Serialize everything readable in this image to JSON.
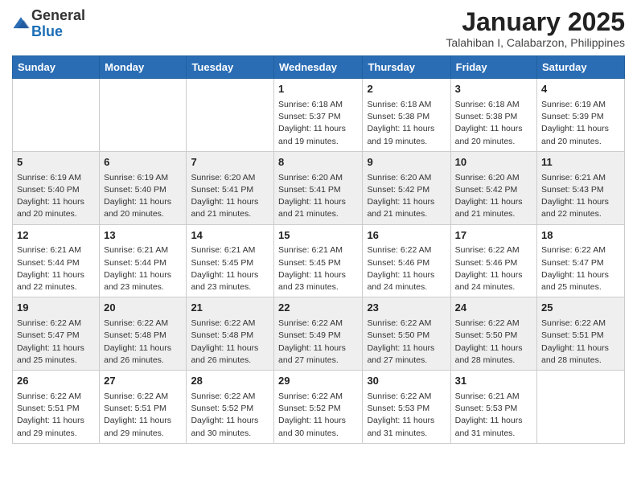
{
  "logo": {
    "line1": "General",
    "line2": "Blue"
  },
  "header": {
    "month": "January 2025",
    "location": "Talahiban I, Calabarzon, Philippines"
  },
  "weekdays": [
    "Sunday",
    "Monday",
    "Tuesday",
    "Wednesday",
    "Thursday",
    "Friday",
    "Saturday"
  ],
  "weeks": [
    [
      {
        "day": "",
        "sunrise": "",
        "sunset": "",
        "daylight": ""
      },
      {
        "day": "",
        "sunrise": "",
        "sunset": "",
        "daylight": ""
      },
      {
        "day": "",
        "sunrise": "",
        "sunset": "",
        "daylight": ""
      },
      {
        "day": "1",
        "sunrise": "Sunrise: 6:18 AM",
        "sunset": "Sunset: 5:37 PM",
        "daylight": "Daylight: 11 hours and 19 minutes."
      },
      {
        "day": "2",
        "sunrise": "Sunrise: 6:18 AM",
        "sunset": "Sunset: 5:38 PM",
        "daylight": "Daylight: 11 hours and 19 minutes."
      },
      {
        "day": "3",
        "sunrise": "Sunrise: 6:18 AM",
        "sunset": "Sunset: 5:38 PM",
        "daylight": "Daylight: 11 hours and 20 minutes."
      },
      {
        "day": "4",
        "sunrise": "Sunrise: 6:19 AM",
        "sunset": "Sunset: 5:39 PM",
        "daylight": "Daylight: 11 hours and 20 minutes."
      }
    ],
    [
      {
        "day": "5",
        "sunrise": "Sunrise: 6:19 AM",
        "sunset": "Sunset: 5:40 PM",
        "daylight": "Daylight: 11 hours and 20 minutes."
      },
      {
        "day": "6",
        "sunrise": "Sunrise: 6:19 AM",
        "sunset": "Sunset: 5:40 PM",
        "daylight": "Daylight: 11 hours and 20 minutes."
      },
      {
        "day": "7",
        "sunrise": "Sunrise: 6:20 AM",
        "sunset": "Sunset: 5:41 PM",
        "daylight": "Daylight: 11 hours and 21 minutes."
      },
      {
        "day": "8",
        "sunrise": "Sunrise: 6:20 AM",
        "sunset": "Sunset: 5:41 PM",
        "daylight": "Daylight: 11 hours and 21 minutes."
      },
      {
        "day": "9",
        "sunrise": "Sunrise: 6:20 AM",
        "sunset": "Sunset: 5:42 PM",
        "daylight": "Daylight: 11 hours and 21 minutes."
      },
      {
        "day": "10",
        "sunrise": "Sunrise: 6:20 AM",
        "sunset": "Sunset: 5:42 PM",
        "daylight": "Daylight: 11 hours and 21 minutes."
      },
      {
        "day": "11",
        "sunrise": "Sunrise: 6:21 AM",
        "sunset": "Sunset: 5:43 PM",
        "daylight": "Daylight: 11 hours and 22 minutes."
      }
    ],
    [
      {
        "day": "12",
        "sunrise": "Sunrise: 6:21 AM",
        "sunset": "Sunset: 5:44 PM",
        "daylight": "Daylight: 11 hours and 22 minutes."
      },
      {
        "day": "13",
        "sunrise": "Sunrise: 6:21 AM",
        "sunset": "Sunset: 5:44 PM",
        "daylight": "Daylight: 11 hours and 23 minutes."
      },
      {
        "day": "14",
        "sunrise": "Sunrise: 6:21 AM",
        "sunset": "Sunset: 5:45 PM",
        "daylight": "Daylight: 11 hours and 23 minutes."
      },
      {
        "day": "15",
        "sunrise": "Sunrise: 6:21 AM",
        "sunset": "Sunset: 5:45 PM",
        "daylight": "Daylight: 11 hours and 23 minutes."
      },
      {
        "day": "16",
        "sunrise": "Sunrise: 6:22 AM",
        "sunset": "Sunset: 5:46 PM",
        "daylight": "Daylight: 11 hours and 24 minutes."
      },
      {
        "day": "17",
        "sunrise": "Sunrise: 6:22 AM",
        "sunset": "Sunset: 5:46 PM",
        "daylight": "Daylight: 11 hours and 24 minutes."
      },
      {
        "day": "18",
        "sunrise": "Sunrise: 6:22 AM",
        "sunset": "Sunset: 5:47 PM",
        "daylight": "Daylight: 11 hours and 25 minutes."
      }
    ],
    [
      {
        "day": "19",
        "sunrise": "Sunrise: 6:22 AM",
        "sunset": "Sunset: 5:47 PM",
        "daylight": "Daylight: 11 hours and 25 minutes."
      },
      {
        "day": "20",
        "sunrise": "Sunrise: 6:22 AM",
        "sunset": "Sunset: 5:48 PM",
        "daylight": "Daylight: 11 hours and 26 minutes."
      },
      {
        "day": "21",
        "sunrise": "Sunrise: 6:22 AM",
        "sunset": "Sunset: 5:48 PM",
        "daylight": "Daylight: 11 hours and 26 minutes."
      },
      {
        "day": "22",
        "sunrise": "Sunrise: 6:22 AM",
        "sunset": "Sunset: 5:49 PM",
        "daylight": "Daylight: 11 hours and 27 minutes."
      },
      {
        "day": "23",
        "sunrise": "Sunrise: 6:22 AM",
        "sunset": "Sunset: 5:50 PM",
        "daylight": "Daylight: 11 hours and 27 minutes."
      },
      {
        "day": "24",
        "sunrise": "Sunrise: 6:22 AM",
        "sunset": "Sunset: 5:50 PM",
        "daylight": "Daylight: 11 hours and 28 minutes."
      },
      {
        "day": "25",
        "sunrise": "Sunrise: 6:22 AM",
        "sunset": "Sunset: 5:51 PM",
        "daylight": "Daylight: 11 hours and 28 minutes."
      }
    ],
    [
      {
        "day": "26",
        "sunrise": "Sunrise: 6:22 AM",
        "sunset": "Sunset: 5:51 PM",
        "daylight": "Daylight: 11 hours and 29 minutes."
      },
      {
        "day": "27",
        "sunrise": "Sunrise: 6:22 AM",
        "sunset": "Sunset: 5:51 PM",
        "daylight": "Daylight: 11 hours and 29 minutes."
      },
      {
        "day": "28",
        "sunrise": "Sunrise: 6:22 AM",
        "sunset": "Sunset: 5:52 PM",
        "daylight": "Daylight: 11 hours and 30 minutes."
      },
      {
        "day": "29",
        "sunrise": "Sunrise: 6:22 AM",
        "sunset": "Sunset: 5:52 PM",
        "daylight": "Daylight: 11 hours and 30 minutes."
      },
      {
        "day": "30",
        "sunrise": "Sunrise: 6:22 AM",
        "sunset": "Sunset: 5:53 PM",
        "daylight": "Daylight: 11 hours and 31 minutes."
      },
      {
        "day": "31",
        "sunrise": "Sunrise: 6:21 AM",
        "sunset": "Sunset: 5:53 PM",
        "daylight": "Daylight: 11 hours and 31 minutes."
      },
      {
        "day": "",
        "sunrise": "",
        "sunset": "",
        "daylight": ""
      }
    ]
  ]
}
